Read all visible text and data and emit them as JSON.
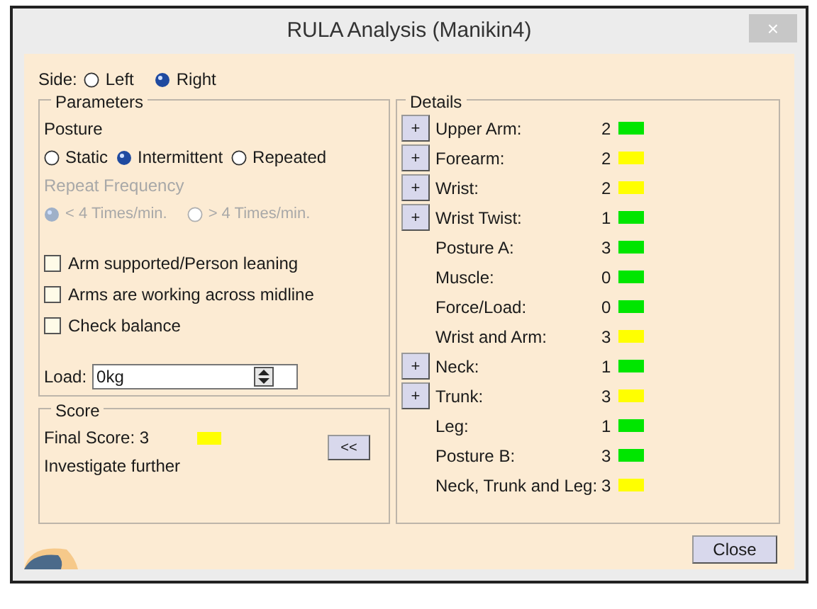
{
  "window": {
    "title": "RULA Analysis (Manikin4)",
    "close": "×"
  },
  "side": {
    "label": "Side:",
    "options": [
      {
        "label": "Left",
        "selected": false
      },
      {
        "label": "Right",
        "selected": true
      }
    ]
  },
  "parameters": {
    "title": "Parameters",
    "posture_label": "Posture",
    "posture": [
      {
        "label": "Static",
        "selected": false
      },
      {
        "label": "Intermittent",
        "selected": true
      },
      {
        "label": "Repeated",
        "selected": false
      }
    ],
    "repeat_label": "Repeat Frequency",
    "repeat_disabled": true,
    "repeat": [
      {
        "label": "< 4 Times/min.",
        "selected": true
      },
      {
        "label": "> 4 Times/min.",
        "selected": false
      }
    ],
    "checks": [
      {
        "label": "Arm supported/Person leaning",
        "checked": false
      },
      {
        "label": "Arms are working across midline",
        "checked": false
      },
      {
        "label": "Check balance",
        "checked": false
      }
    ],
    "load": {
      "label": "Load:",
      "value": "0kg"
    }
  },
  "score": {
    "title": "Score",
    "final": "Final Score: 3",
    "color": "#ffff00",
    "verdict": "Investigate further",
    "toggle": "<<"
  },
  "details": {
    "title": "Details",
    "rows": [
      {
        "button": "+",
        "label": "Upper Arm:",
        "value": "2",
        "color": "#00e600"
      },
      {
        "button": "+",
        "label": "Forearm:",
        "value": "2",
        "color": "#ffff00"
      },
      {
        "button": "+",
        "label": "Wrist:",
        "value": "2",
        "color": "#ffff00"
      },
      {
        "button": "+",
        "label": "Wrist Twist:",
        "value": "1",
        "color": "#00e600"
      },
      {
        "label": "Posture A:",
        "value": "3",
        "color": "#00e600"
      },
      {
        "label": "Muscle:",
        "value": "0",
        "color": "#00e600"
      },
      {
        "label": "Force/Load:",
        "value": "0",
        "color": "#00e600"
      },
      {
        "label": "Wrist and Arm:",
        "value": "3",
        "color": "#ffff00"
      },
      {
        "button": "+",
        "label": "Neck:",
        "value": "1",
        "color": "#00e600"
      },
      {
        "button": "+",
        "label": "Trunk:",
        "value": "3",
        "color": "#ffff00"
      },
      {
        "label": "Leg:",
        "value": "1",
        "color": "#00e600"
      },
      {
        "label": "Posture B:",
        "value": "3",
        "color": "#00e600"
      },
      {
        "label": "Neck, Trunk and Leg:",
        "value": "3",
        "color": "#ffff00"
      }
    ]
  },
  "buttons": [
    "Close"
  ]
}
